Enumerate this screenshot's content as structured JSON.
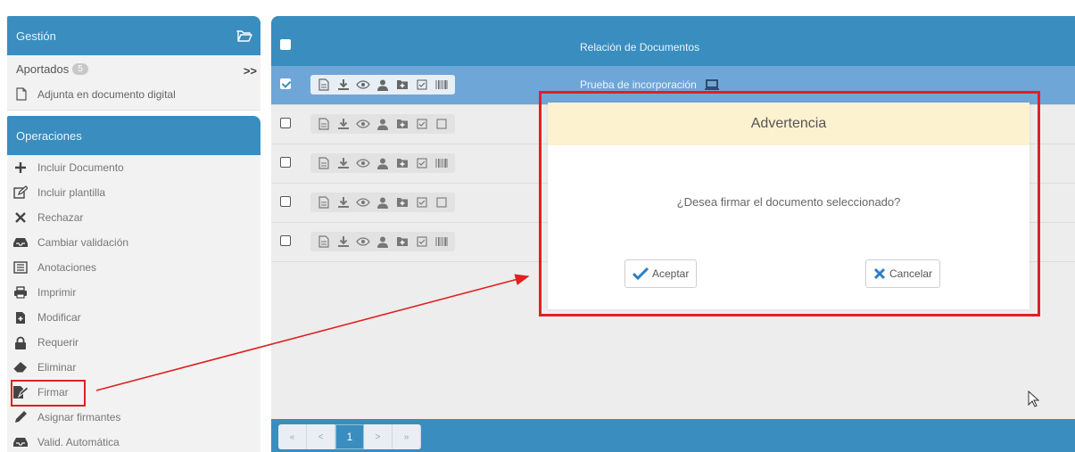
{
  "sidebar": {
    "gestion": {
      "title": "Gestión",
      "aportados_label": "Aportados",
      "aportados_count": "5",
      "expand_glyph": ">>",
      "adjunta_label": "Adjunta en documento digital"
    },
    "operaciones": {
      "title": "Operaciones",
      "items": [
        {
          "label": "Incluir Documento",
          "icon": "plus-icon"
        },
        {
          "label": "Incluir plantilla",
          "icon": "edit-template-icon"
        },
        {
          "label": "Rechazar",
          "icon": "close-icon"
        },
        {
          "label": "Cambiar validación",
          "icon": "inbox-icon"
        },
        {
          "label": "Anotaciones",
          "icon": "list-icon"
        },
        {
          "label": "Imprimir",
          "icon": "print-icon"
        },
        {
          "label": "Modificar",
          "icon": "file-plus-icon"
        },
        {
          "label": "Requerir",
          "icon": "lock-icon"
        },
        {
          "label": "Eliminar",
          "icon": "eraser-icon"
        },
        {
          "label": "Firmar",
          "icon": "sign-icon"
        },
        {
          "label": "Asignar firmantes",
          "icon": "pencil-icon"
        },
        {
          "label": "Valid. Automática",
          "icon": "inbox-icon"
        }
      ]
    }
  },
  "table": {
    "header_title": "Relación de Documentos",
    "rows": [
      {
        "selected": true,
        "title": "Prueba de incorporación",
        "last_tool": "barcode-icon"
      },
      {
        "selected": false,
        "title": "",
        "last_tool": "square-icon"
      },
      {
        "selected": false,
        "title": "",
        "last_tool": "barcode-icon"
      },
      {
        "selected": false,
        "title": "",
        "last_tool": "square-icon"
      },
      {
        "selected": false,
        "title": "",
        "last_tool": "barcode-icon"
      }
    ]
  },
  "pager": {
    "first": "«",
    "prev": "<",
    "current": "1",
    "next": ">",
    "last": "»"
  },
  "modal": {
    "title": "Advertencia",
    "message": "¿Desea firmar el documento seleccionado?",
    "accept_label": "Aceptar",
    "cancel_label": "Cancelar"
  },
  "colors": {
    "primary": "#3a8dbf",
    "selected_row": "#6fa6d8",
    "modal_header": "#fdf2cf",
    "highlight": "#e02020",
    "accept_icon": "#2a7fc7",
    "cancel_icon": "#2a7fc7"
  }
}
